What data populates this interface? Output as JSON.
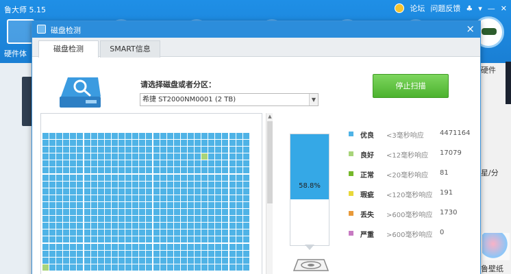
{
  "app": {
    "title": "鲁大师 5.15",
    "top_links": [
      "论坛",
      "问题反馈"
    ],
    "window_controls": [
      "♣",
      "▾",
      "—",
      "✕"
    ],
    "nav_label": "硬件体",
    "right_texts": [
      "硬件",
      "星/分",
      "鲁壁纸"
    ]
  },
  "dialog": {
    "title": "磁盘检测",
    "close": "×",
    "tabs": [
      {
        "label": "磁盘检测",
        "active": true
      },
      {
        "label": "SMART信息",
        "active": false
      }
    ],
    "select_label": "请选择磁盘或者分区：",
    "selected_disk": "希捷  ST2000NM0001  (2 TB)",
    "stop_button": "停止扫描",
    "progress": {
      "percent": 58.8,
      "label": "58.8%"
    },
    "legend": [
      {
        "name": "优良",
        "desc": "<3毫秒响应",
        "count": "4471164",
        "color": "#4fb3e6"
      },
      {
        "name": "良好",
        "desc": "<12毫秒响应",
        "count": "17079",
        "color": "#a8d47a"
      },
      {
        "name": "正常",
        "desc": "<20毫秒响应",
        "count": "81",
        "color": "#76b82a"
      },
      {
        "name": "瑕疵",
        "desc": "<120毫秒响应",
        "count": "191",
        "color": "#e8d83a"
      },
      {
        "name": "丢失",
        "desc": ">600毫秒响应",
        "count": "1730",
        "color": "#e89a3a"
      },
      {
        "name": "严重",
        "desc": ">600毫秒响应",
        "count": "0",
        "color": "#c77ac2"
      }
    ]
  }
}
